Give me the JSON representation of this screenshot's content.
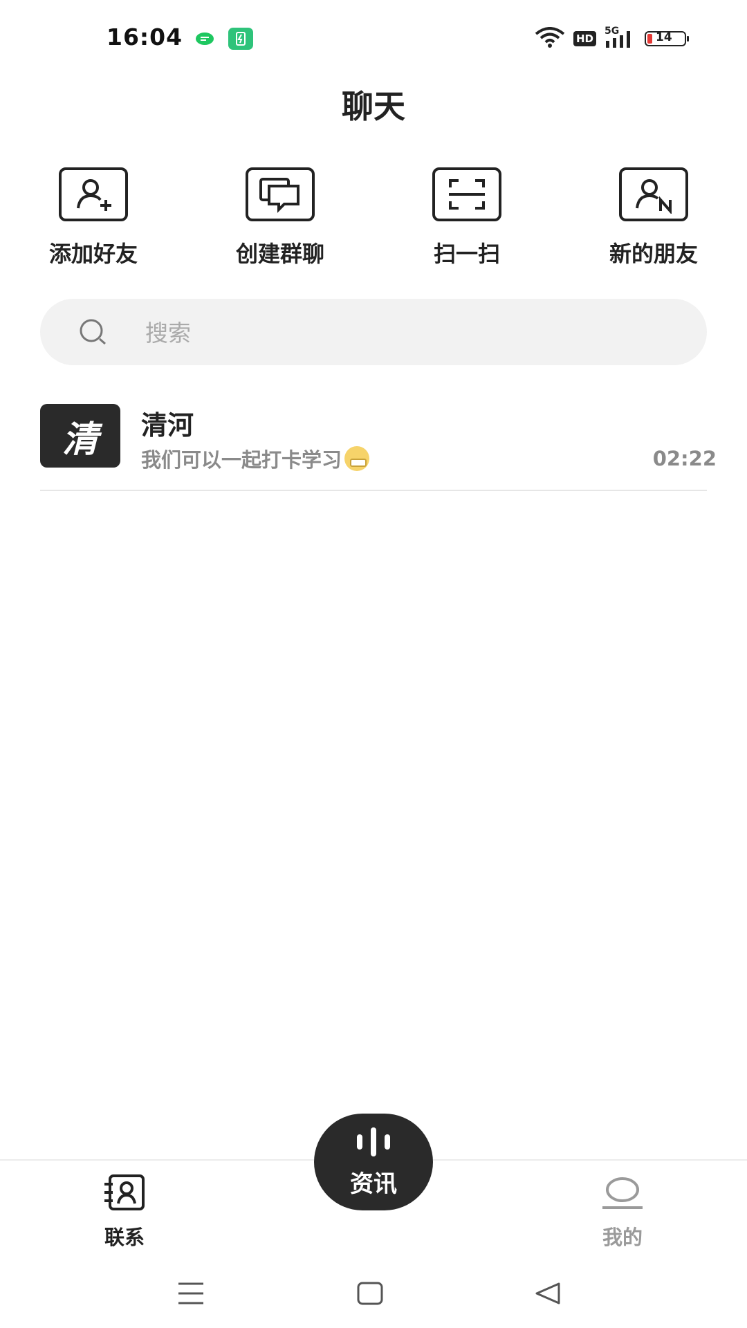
{
  "status_bar": {
    "time": "16:04",
    "network": "5G",
    "hd": "HD",
    "battery": "14",
    "battery_color": "#e53935"
  },
  "header": {
    "title": "聊天"
  },
  "quick_actions": [
    {
      "label": "添加好友",
      "icon": "add-friend-icon"
    },
    {
      "label": "创建群聊",
      "icon": "group-chat-icon"
    },
    {
      "label": "扫一扫",
      "icon": "scan-icon"
    },
    {
      "label": "新的朋友",
      "icon": "new-friend-icon"
    }
  ],
  "search": {
    "placeholder": "搜索",
    "value": ""
  },
  "chats": [
    {
      "avatar_text": "清",
      "name": "清河",
      "preview": "我们可以一起打卡学习",
      "preview_emoji": "grin-emoji",
      "time": "02:22"
    }
  ],
  "bottom_nav": {
    "contacts_label": "联系",
    "center_label": "资讯",
    "mine_label": "我的"
  },
  "colors": {
    "accent_dark": "#2a2a2a",
    "muted_text": "#8a8a8a",
    "search_bg": "#f2f2f2"
  }
}
